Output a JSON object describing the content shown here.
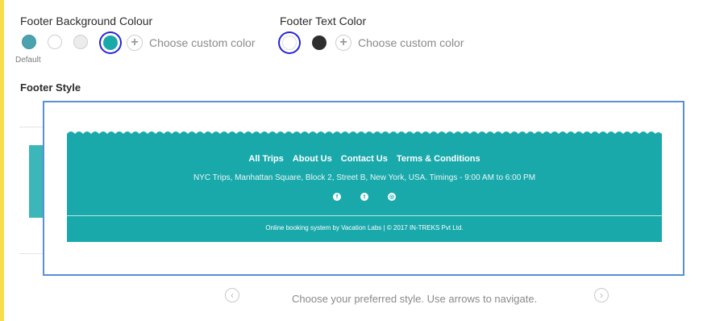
{
  "footer_background": {
    "label": "Footer Background Colour",
    "default_label": "Default",
    "swatches": [
      {
        "color": "#4aa3ae",
        "selected": false
      },
      {
        "color": "#ffffff",
        "selected": false
      },
      {
        "color": "#ececec",
        "selected": false
      },
      {
        "color": "#1aa9ab",
        "selected": true
      }
    ],
    "custom_label": "Choose custom color"
  },
  "footer_text": {
    "label": "Footer Text Color",
    "swatches": [
      {
        "color": "#ffffff",
        "selected": true
      },
      {
        "color": "#2e2e2e",
        "selected": false
      }
    ],
    "custom_label": "Choose custom color"
  },
  "footer_style": {
    "label": "Footer Style",
    "preview": {
      "links": [
        "All Trips",
        "About Us",
        "Contact Us",
        "Terms & Conditions"
      ],
      "address": "NYC Trips,  Manhattan Square, Block 2, Street B, New York, USA. Timings  - 9:00 AM to 6:00 PM",
      "social_icons": [
        "facebook-icon",
        "twitter-icon",
        "instagram-icon"
      ],
      "copyright": "Online booking system by Vacation Labs | © 2017 IN-TREKS Pvt Ltd."
    },
    "helper_text": "Choose your preferred style. Use arrows to navigate."
  },
  "colors": {
    "accent": "#1aa9ab",
    "selection_ring": "#2424d8",
    "frame_border": "#5b8fd3",
    "side_bar": "#f7dd4b"
  }
}
